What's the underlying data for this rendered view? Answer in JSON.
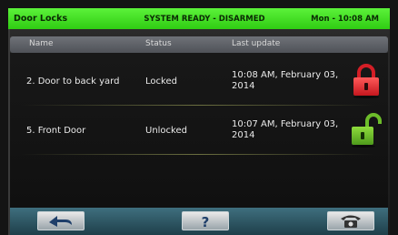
{
  "header": {
    "title": "Door Locks",
    "system_status": "SYSTEM READY - DISARMED",
    "datetime": "Mon - 10:08 AM"
  },
  "table": {
    "columns": [
      "Name",
      "Status",
      "Last update"
    ],
    "rows": [
      {
        "name": "2. Door to back yard",
        "status": "Locked",
        "last_update": "10:08 AM, February 03, 2014",
        "icon": "padlock-locked-red-icon"
      },
      {
        "name": "5. Front Door",
        "status": "Unlocked",
        "last_update": "10:07 AM, February 03, 2014",
        "icon": "padlock-unlocked-green-icon"
      }
    ]
  },
  "footer": {
    "buttons": [
      {
        "icon": "back-arrow-icon"
      },
      {
        "icon": "help-question-icon"
      },
      {
        "icon": "phone-icon"
      }
    ]
  },
  "colors": {
    "header_green": "#3bdc1c",
    "locked_red": "#e0262d",
    "unlocked_green": "#6dbd2a"
  }
}
